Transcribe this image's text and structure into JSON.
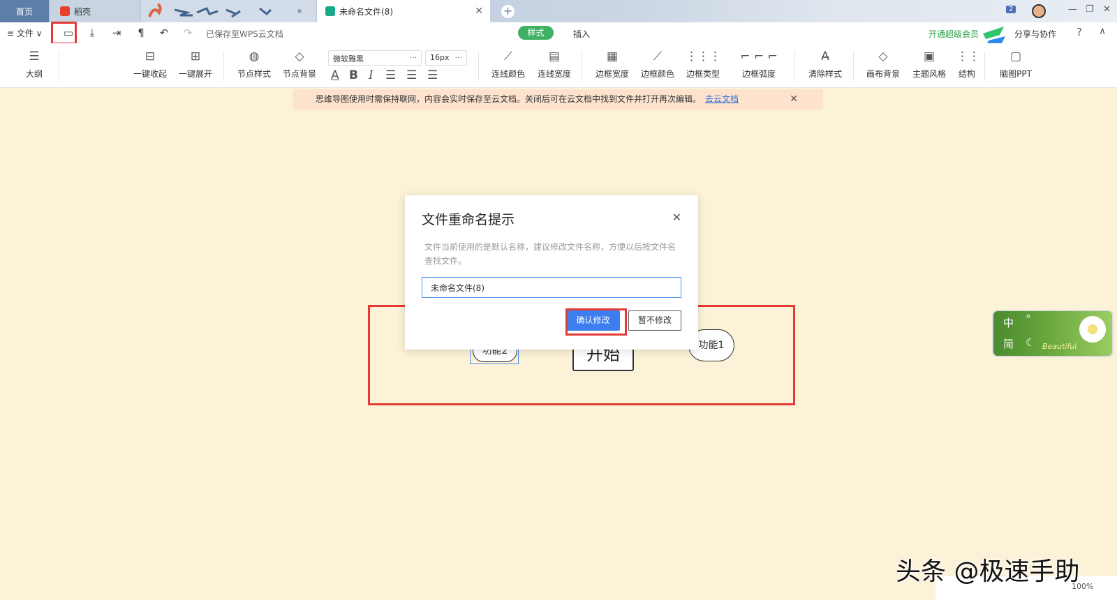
{
  "tabs": {
    "home": "首页",
    "daoke": "稻壳",
    "document": "未命名文件(8)",
    "tab_count": "2"
  },
  "menu": {
    "file": "≡ 文件 ∨",
    "saved_status": "已保存至WPS云文档",
    "tab_style": "样式",
    "tab_insert": "插入",
    "vip": "开通超级会员",
    "share": "分享与协作"
  },
  "ribbon": {
    "outline": "大纲",
    "collapse_all": "一键收起",
    "expand_all": "一键展开",
    "node_style": "节点样式",
    "node_background": "节点背景",
    "font_family": "微软雅黑",
    "font_size": "16px",
    "line_color": "连线颜色",
    "line_width": "连线宽度",
    "border_width": "边框宽度",
    "border_color": "边框颜色",
    "border_type": "边框类型",
    "border_radius": "边框弧度",
    "clear_style": "清除样式",
    "canvas_background": "画布背景",
    "theme": "主题风格",
    "structure": "结构",
    "mindmap_ppt": "脑图PPT"
  },
  "notice": {
    "text": "思维导图使用时需保持联网，内容会实时保存至云文档。关闭后可在云文档中找到文件并打开再次编辑。",
    "link": "去云文档"
  },
  "canvas": {
    "node_func2": "功能2",
    "node_start": "开始",
    "node_func1": "功能1"
  },
  "dialog": {
    "title": "文件重命名提示",
    "description": "文件当前使用的是默认名称，建议修改文件名称，方便以后按文件名查找文件。",
    "input_value": "未命名文件(8)",
    "confirm": "确认修改",
    "cancel": "暂不修改"
  },
  "ime": {
    "lang": "中",
    "punct": "°",
    "script": "简",
    "moon": "☾",
    "deco": "Beautiful"
  },
  "watermark": "头条 @极速手助",
  "zoom": "100%",
  "colors": {
    "accent_green": "#3fb165",
    "primary_blue": "#3c7ef0",
    "highlight_red": "#e53935",
    "canvas_bg": "#fcf2d8"
  }
}
